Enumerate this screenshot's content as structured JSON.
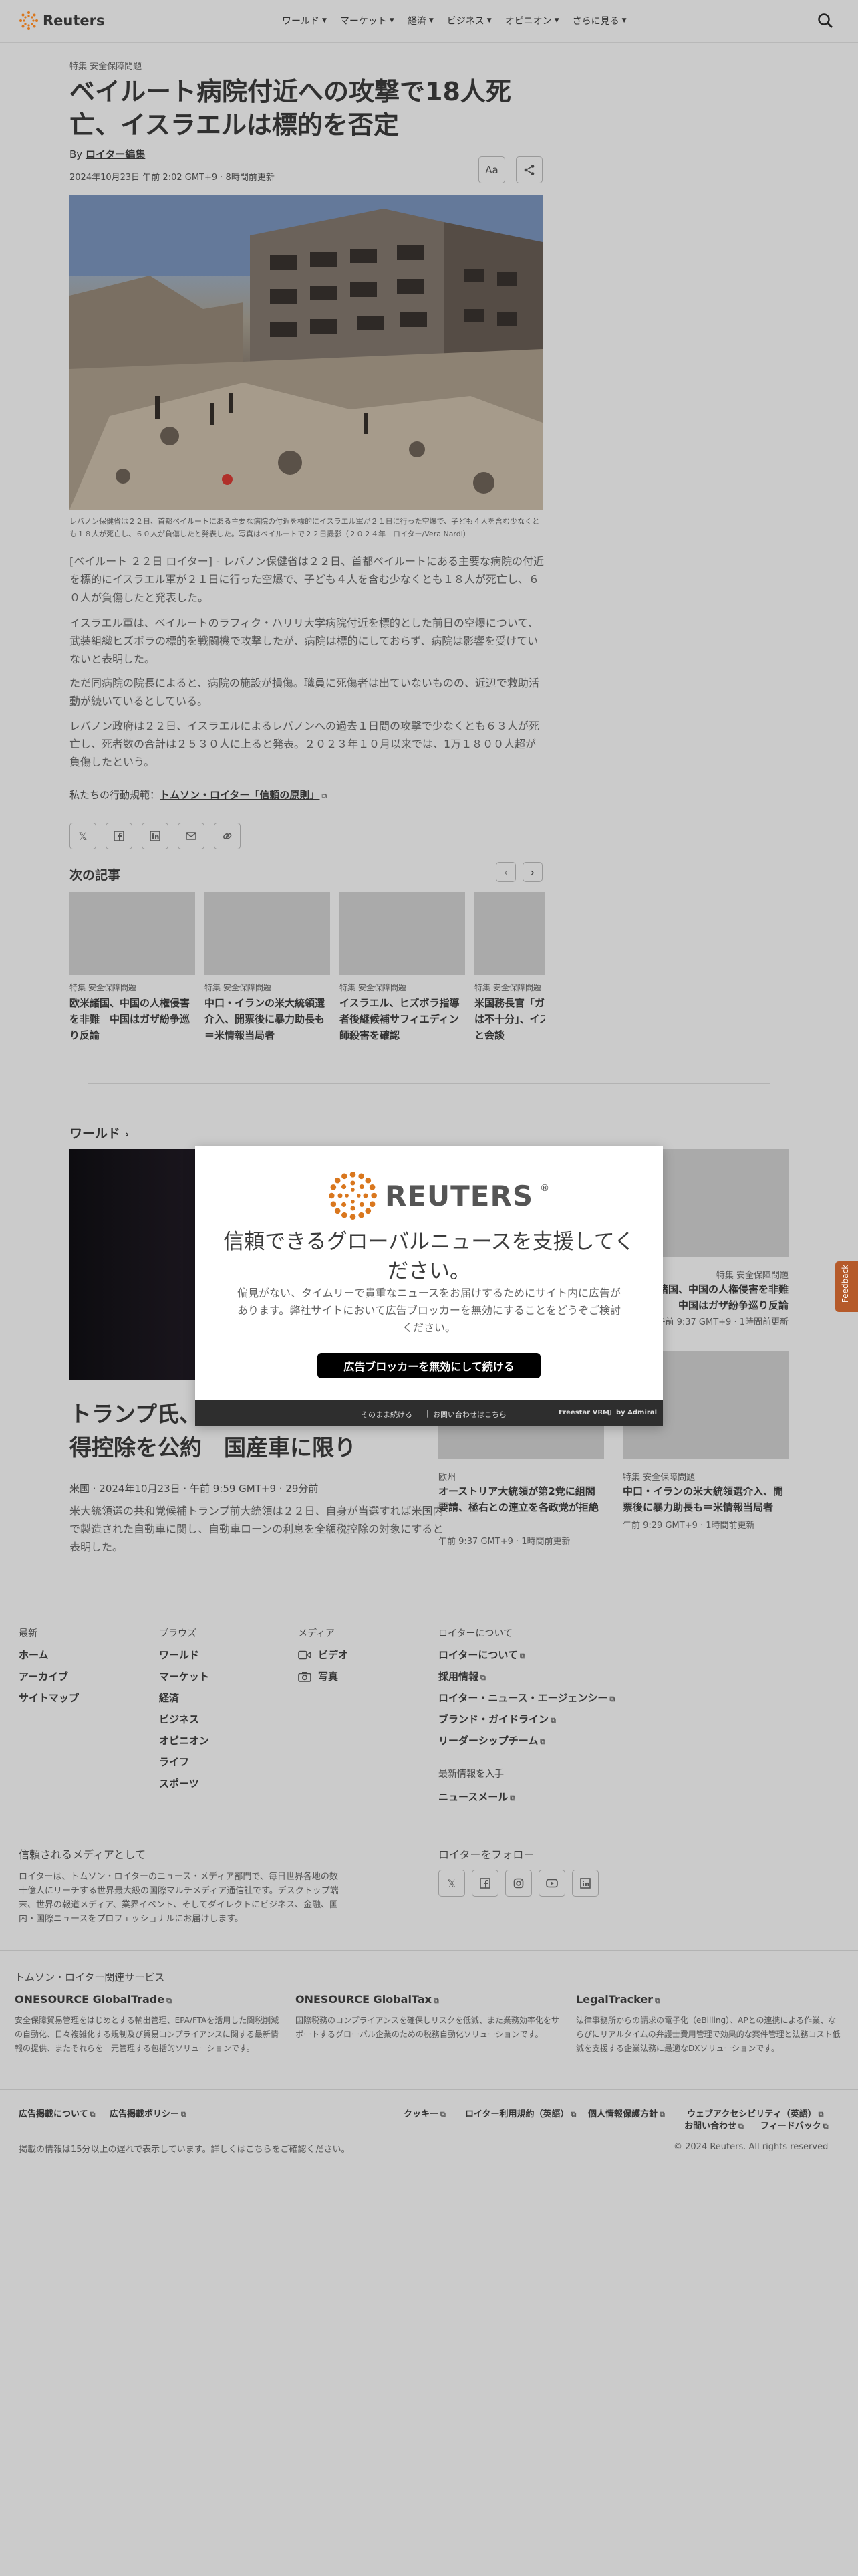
{
  "header": {
    "logo_text": "Reuters",
    "nav": [
      "ワールド",
      "マーケット",
      "経済",
      "ビジネス",
      "オピニオン",
      "さらに見る"
    ]
  },
  "article": {
    "kicker": "特集 安全保障問題",
    "headline": "ベイルート病院付近への攻撃で18人死亡、イスラエルは標的を否定",
    "byline_prefix": "By",
    "byline_author": "ロイター編集",
    "dateline": "2024年10月23日 午前 2:02 GMT+9 · 8時間前更新",
    "font_button": "Aa",
    "caption": "レバノン保健省は２２日、首都ベイルートにある主要な病院の付近を標的にイスラエル軍が２１日に行った空爆で、子ども４人を含む少なくとも１８人が死亡し、６０人が負傷したと発表した。写真はベイルートで２２日撮影（２０２４年　ロイター/Vera Nardi）",
    "paragraphs": [
      "[ベイルート ２２日 ロイター] - レバノン保健省は２２日、首都ベイルートにある主要な病院の付近を標的にイスラエル軍が２１日に行った空爆で、子ども４人を含む少なくとも１８人が死亡し、６０人が負傷したと発表した。",
      "イスラエル軍は、ベイルートのラフィク・ハリリ大学病院付近を標的とした前日の空爆について、武装組織ヒズボラの標的を戦闘機で攻撃したが、病院は標的にしておらず、病院は影響を受けていないと表明した。",
      "ただ同病院の院長によると、病院の施設が損傷。職員に死傷者は出ていないものの、近辺で救助活動が続いているとしている。",
      "レバノン政府は２２日、イスラエルによるレバノンへの過去１日間の攻撃で少なくとも６３人が死亡し、死者数の合計は２５３０人に上ると発表。２０２３年１０月以来では、1万１８００人超が負傷したという。"
    ],
    "standards_prefix": "私たちの行動規範：",
    "standards_link": "トムソン・ロイター「信頼の原則」"
  },
  "next": {
    "title": "次の記事",
    "cards": [
      {
        "tag": "特集 安全保障問題",
        "title": "欧米諸国、中国の人権侵害を非難　中国はガザ紛争巡り反論"
      },
      {
        "tag": "特集 安全保障問題",
        "title": "中口・イランの米大統領選介入、開票後に暴力助長も＝米情報当局者"
      },
      {
        "tag": "特集 安全保障問題",
        "title": "イスラエル、ヒズボラ指導者後継候補サフィエディン師殺害を確認"
      },
      {
        "tag": "特集 安全保障問題",
        "title": "米国務長官「ガザ人道支援は不十分」、イスラエル首相と会談"
      }
    ]
  },
  "world": {
    "title": "ワールド",
    "big_title": "トランプ氏、自動車ローン利息の所得控除を公約　国産車に限り",
    "big_meta": "米国 · 2024年10月23日 · 午前 9:59 GMT+9 · 29分前",
    "big_desc": "米大統領選の共和党候補トランプ前大統領は２２日、自身が当選すれば米国内で製造された自動車に関し、自動車ローンの利息を全額税控除の対象にすると表明した。",
    "side": [
      {
        "tag": "特集 安全保障問題",
        "title": "欧米諸国、中国の人権侵害を非難　中国はガザ紛争巡り反論",
        "time": "午前 9:37 GMT+9 · 1時間前更新"
      },
      {
        "tag": "欧州",
        "title": "オーストリア大統領が第2党に組閣要請、極右との連立を各政党が拒絶",
        "time": "午前 9:37 GMT+9 · 1時間前更新"
      },
      {
        "tag": "特集 安全保障問題",
        "title": "中口・イランの米大統領選介入、開票後に暴力助長も＝米情報当局者",
        "time": "午前 9:29 GMT+9 · 1時間前更新"
      }
    ]
  },
  "modal": {
    "brand": "REUTERS",
    "heading": "信頼できるグローバルニュースを支援してください。",
    "body": "偏見がない、タイムリーで貴重なニュースをお届けするためにサイト内に広告があります。弊社サイトにおいて広告ブロッカーを無効にすることをどうぞご検討ください。",
    "button": "広告ブロッカーを無効にして続ける",
    "link_continue": "そのまま続ける",
    "link_contact": "お問い合わせはこちら",
    "powered": "Freestar VRM",
    "powered_by": "by Admiral"
  },
  "footer": {
    "latest": {
      "heading": "最新",
      "links": [
        "ホーム",
        "アーカイブ",
        "サイトマップ"
      ]
    },
    "browse": {
      "heading": "ブラウズ",
      "links": [
        "ワールド",
        "マーケット",
        "経済",
        "ビジネス",
        "オピニオン",
        "ライフ",
        "スポーツ"
      ]
    },
    "media": {
      "heading": "メディア",
      "links": [
        "ビデオ",
        "写真"
      ]
    },
    "about": {
      "heading": "ロイターについて",
      "links": [
        "ロイターについて",
        "採用情報",
        "ロイター・ニュース・エージェンシー",
        "ブランド・ガイドライン",
        "リーダーシップチーム"
      ]
    },
    "newsletter_heading": "最新情報を入手",
    "newsletter_link": "ニュースメール",
    "trusted_title": "信頼されるメディアとして",
    "trusted_text": "ロイターは、トムソン・ロイターのニュース・メディア部門で、毎日世界各地の数十億人にリーチする世界最大級の国際マルチメディア通信社です。デスクトップ端末、世界の報道メディア、業界イベント、そしてダイレクトにビジネス、金融、国内・国際ニュースをプロフェッショナルにお届けします。",
    "follow_title": "ロイターをフォロー",
    "related_title": "トムソン・ロイター関連サービス",
    "related": [
      {
        "title": "ONESOURCE GlobalTrade",
        "desc": "安全保障貿易管理をはじめとする輸出管理、EPA/FTAを活用した関税削減の自動化、日々複雑化する規制及び貿易コンプライアンスに関する最新情報の提供、またそれらを一元管理する包括的ソリューションです。"
      },
      {
        "title": "ONESOURCE GlobalTax",
        "desc": "国際税務のコンプライアンスを確保しリスクを低減、また業務効率化をサポートするグローバル企業のための税務自動化ソリューションです。"
      },
      {
        "title": "LegalTracker",
        "desc": "法律事務所からの請求の電子化（eBilling）、APとの連携による作業、ならびにリアルタイムの弁護士費用管理で効果的な案件管理と法務コスト低減を支援する企業法務に最適なDXソリューションです。"
      }
    ],
    "bottom_links": [
      "広告掲載について",
      "広告掲載ポリシー",
      "クッキー",
      "ロイター利用規約（英語）",
      "個人情報保護方針",
      "ウェブアクセシビリティ（英語）",
      "お問い合わせ",
      "フィードバック"
    ],
    "disclaimer": "掲載の情報は15分以上の遅れで表示しています。詳しくはこちらをご確認ください。",
    "copyright": "© 2024 Reuters. All rights reserved"
  },
  "feedback_tab": "Feedback",
  "colors": {
    "background": "#cbcbcb",
    "modal": "#ffffff",
    "button": "#000000",
    "feedback": "#b55a2a",
    "logo_orange": "#d9771e"
  }
}
